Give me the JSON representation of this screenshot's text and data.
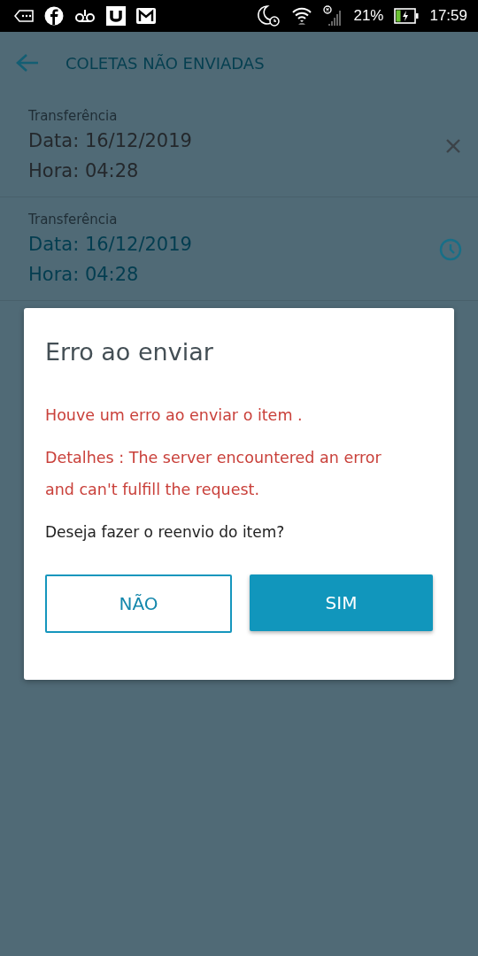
{
  "status_bar": {
    "battery": "21%",
    "time": "17:59"
  },
  "header": {
    "title": "COLETAS NÃO ENVIADAS"
  },
  "items": [
    {
      "kind": "error",
      "type": "Transferência",
      "date": "Data: 16/12/2019",
      "time": "Hora: 04:28"
    },
    {
      "kind": "pending",
      "type": "Transferência",
      "date": "Data: 16/12/2019",
      "time": "Hora: 04:28"
    }
  ],
  "dialog": {
    "title": "Erro ao enviar",
    "error": "Houve um erro ao enviar o item .",
    "details": "Detalhes : The server encountered an error and can't fulfill the request.",
    "question": "Deseja fazer o reenvio do item?",
    "buttons": [
      {
        "label": "NÃO",
        "kind": "outline"
      },
      {
        "label": "SIM",
        "kind": "filled"
      }
    ]
  }
}
